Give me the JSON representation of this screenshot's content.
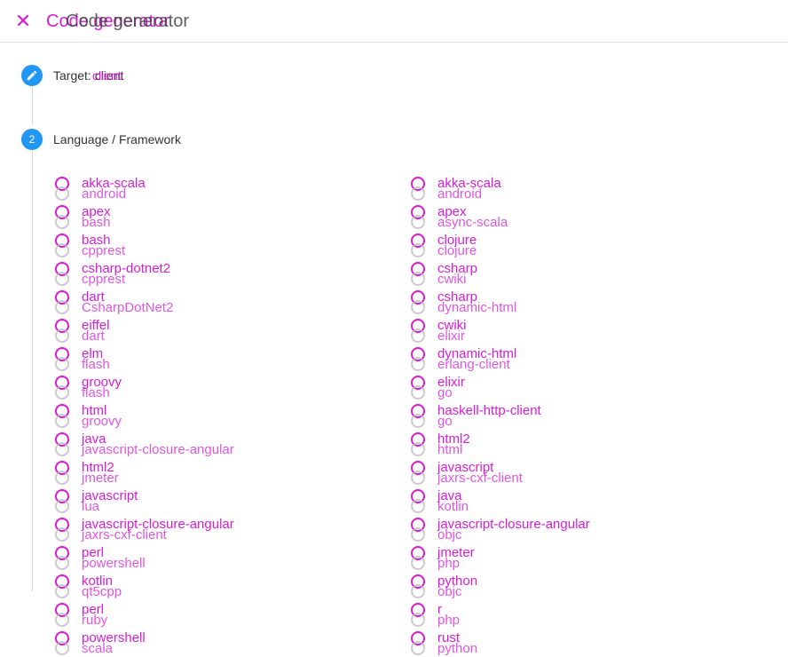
{
  "header": {
    "title": "Code generator",
    "close_icon": "close-icon"
  },
  "steps": {
    "target": {
      "label": "Target: client",
      "overlay": "client",
      "icon": "pencil-icon"
    },
    "language": {
      "number": "2",
      "label": "Language / Framework"
    }
  },
  "options": {
    "left": [
      {
        "primary": "akka-scala",
        "secondary": "android"
      },
      {
        "primary": "apex",
        "secondary": "bash"
      },
      {
        "primary": "bash",
        "secondary": "cpprest"
      },
      {
        "primary": "csharp-dotnet2",
        "secondary": "cpprest"
      },
      {
        "primary": "dart",
        "secondary": "CsharpDotNet2"
      },
      {
        "primary": "eiffel",
        "secondary": "dart"
      },
      {
        "primary": "elm",
        "secondary": "flash"
      },
      {
        "primary": "groovy",
        "secondary": "flash"
      },
      {
        "primary": "html",
        "secondary": "groovy"
      },
      {
        "primary": "java",
        "secondary": "javascript-closure-angular"
      },
      {
        "primary": "html2",
        "secondary": "jmeter"
      },
      {
        "primary": "javascript",
        "secondary": "lua"
      },
      {
        "primary": "javascript-closure-angular",
        "secondary": "jaxrs-cxf-client"
      },
      {
        "primary": "perl",
        "secondary": "powershell"
      },
      {
        "primary": "kotlin",
        "secondary": "qt5cpp"
      },
      {
        "primary": "perl",
        "secondary": "ruby"
      },
      {
        "primary": "powershell",
        "secondary": "scala"
      }
    ],
    "right": [
      {
        "primary": "akka-scala",
        "secondary": "android"
      },
      {
        "primary": "apex",
        "secondary": "async-scala"
      },
      {
        "primary": "clojure",
        "secondary": "clojure"
      },
      {
        "primary": "csharp",
        "secondary": "cwiki"
      },
      {
        "primary": "csharp",
        "secondary": "dynamic-html"
      },
      {
        "primary": "cwiki",
        "secondary": "elixir"
      },
      {
        "primary": "dynamic-html",
        "secondary": "erlang-client"
      },
      {
        "primary": "elixir",
        "secondary": "go"
      },
      {
        "primary": "haskell-http-client",
        "secondary": "go"
      },
      {
        "primary": "html2",
        "secondary": "html"
      },
      {
        "primary": "javascript",
        "secondary": "jaxrs-cxf-client"
      },
      {
        "primary": "java",
        "secondary": "kotlin"
      },
      {
        "primary": "javascript-closure-angular",
        "secondary": "objc"
      },
      {
        "primary": "jmeter",
        "secondary": "php"
      },
      {
        "primary": "python",
        "secondary": "objc"
      },
      {
        "primary": "r",
        "secondary": "php"
      },
      {
        "primary": "rust",
        "secondary": "python"
      }
    ]
  },
  "colors": {
    "accent": "#d81bd8",
    "step": "#2196f3"
  }
}
